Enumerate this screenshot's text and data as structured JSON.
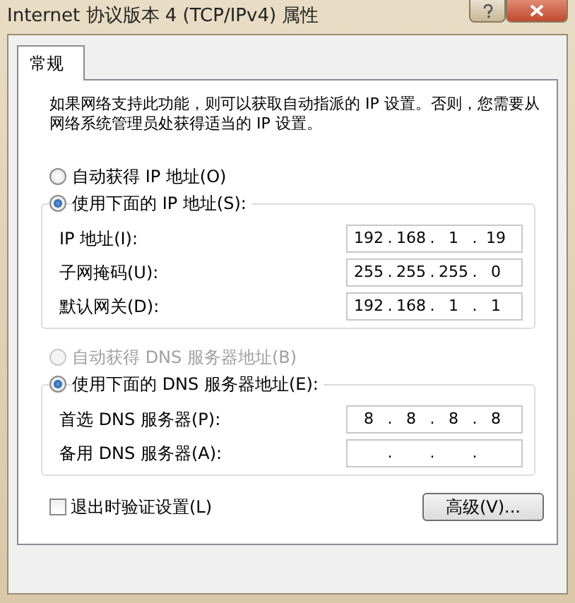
{
  "window": {
    "title": "Internet 协议版本 4 (TCP/IPv4) 属性"
  },
  "tabs": [
    {
      "label": "常规",
      "selected": true
    }
  ],
  "intro": "如果网络支持此功能，则可以获取自动指派的 IP 设置。否则，您需要从网络系统管理员处获得适当的 IP 设置。",
  "ip_section": {
    "options": [
      {
        "label": "自动获得 IP 地址(O)",
        "selected": false,
        "disabled": false
      },
      {
        "label": "使用下面的 IP 地址(S):",
        "selected": true,
        "disabled": false
      }
    ],
    "fields": [
      {
        "label": "IP 地址(I):",
        "segments": [
          "192",
          "168",
          "1",
          "19"
        ],
        "dots": [
          ".",
          ".",
          "."
        ]
      },
      {
        "label": "子网掩码(U):",
        "segments": [
          "255",
          "255",
          "255",
          "0"
        ],
        "dots": [
          ".",
          ".",
          "."
        ]
      },
      {
        "label": "默认网关(D):",
        "segments": [
          "192",
          "168",
          "1",
          "1"
        ],
        "dots": [
          ".",
          ".",
          "."
        ]
      }
    ]
  },
  "dns_section": {
    "options": [
      {
        "label": "自动获得 DNS 服务器地址(B)",
        "selected": false,
        "disabled": true
      },
      {
        "label": "使用下面的 DNS 服务器地址(E):",
        "selected": true,
        "disabled": false
      }
    ],
    "fields": [
      {
        "label": "首选 DNS 服务器(P):",
        "segments": [
          "8",
          "8",
          "8",
          "8"
        ],
        "dots": [
          ".",
          ".",
          "."
        ]
      },
      {
        "label": "备用 DNS 服务器(A):",
        "dots": [
          ".",
          ".",
          "."
        ]
      }
    ]
  },
  "validate": {
    "label": "退出时验证设置(L)",
    "checked": false
  },
  "advanced_button": "高级(V)..."
}
